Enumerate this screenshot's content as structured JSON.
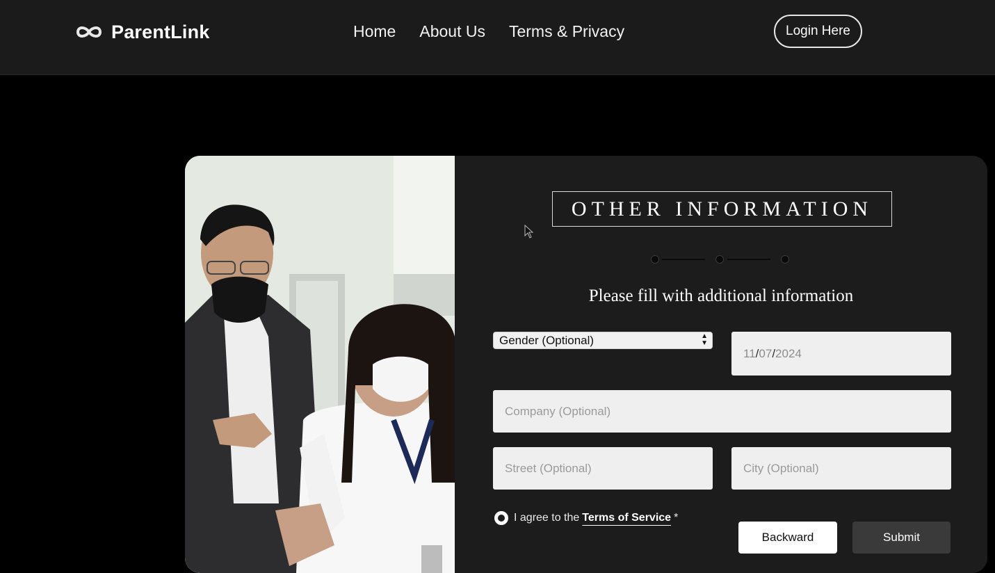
{
  "nav": {
    "brand": "ParentLink",
    "links": [
      "Home",
      "About Us",
      "Terms & Privacy"
    ],
    "login_label": "Login Here"
  },
  "form": {
    "title": "OTHER INFORMATION",
    "subtitle": "Please fill with additional information",
    "gender_select": "Gender (Optional)",
    "date": {
      "month": "11",
      "day": "07",
      "year": "2024"
    },
    "company_placeholder": "Company (Optional)",
    "street_placeholder": "Street (Optional)",
    "city_placeholder": "City (Optional)",
    "agree_text": "I agree to the",
    "terms_link": "Terms of Service",
    "required_mark": "*",
    "backward_label": "Backward",
    "submit_label": "Submit"
  },
  "colors": {
    "nav_bg": "#1b1b1b",
    "page_bg": "#000000",
    "panel_bg": "#1c1c1c",
    "field_bg": "#efefef",
    "submit_bg": "#3a3a3a"
  }
}
